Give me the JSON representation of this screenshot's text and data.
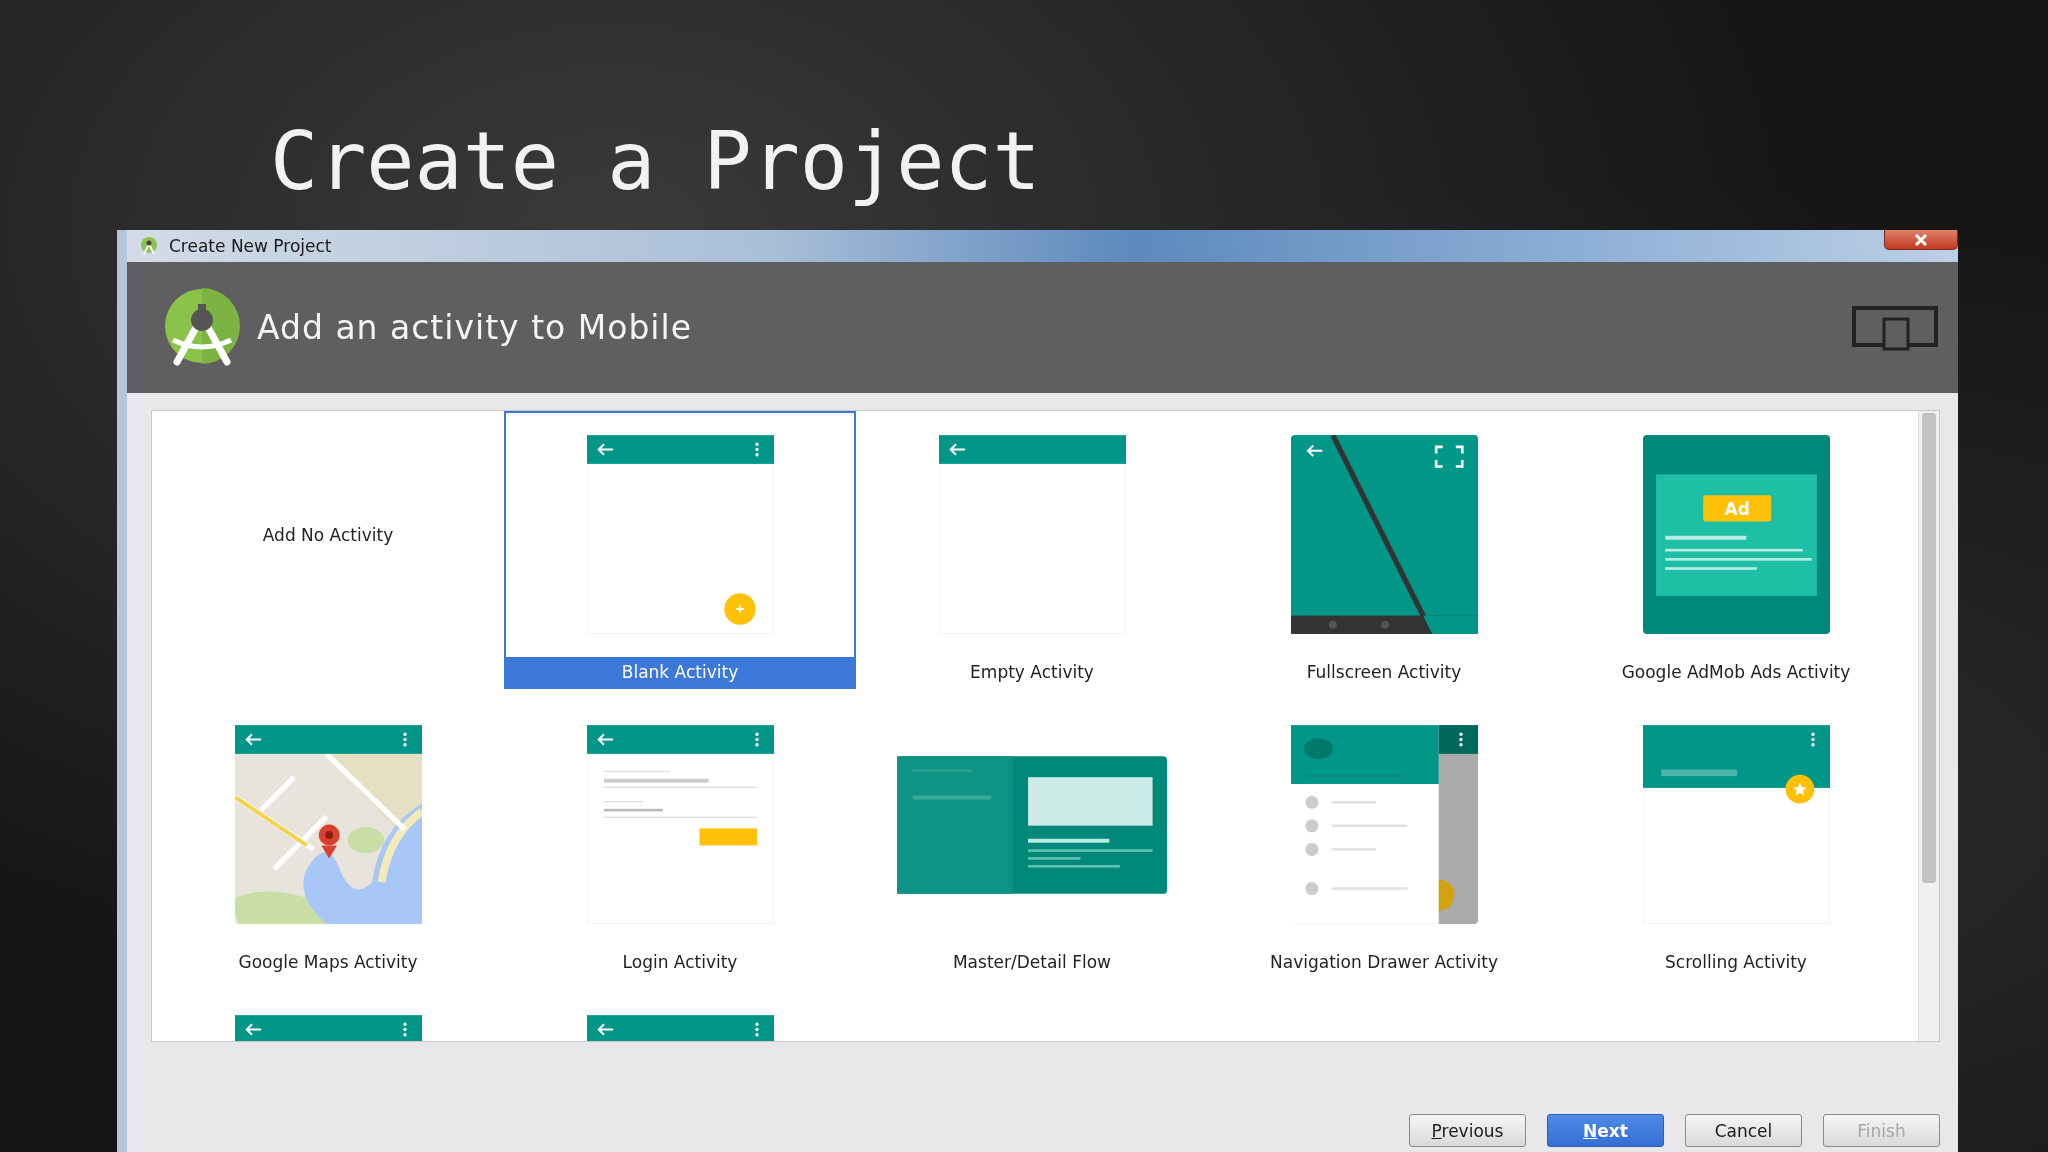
{
  "slide": {
    "title": "Create a Project"
  },
  "window": {
    "title": "Create New Project",
    "header": "Add an activity to Mobile"
  },
  "tiles": [
    {
      "kind": "none",
      "label": "Add No Activity",
      "selected": false
    },
    {
      "kind": "blank",
      "label": "Blank Activity",
      "selected": true
    },
    {
      "kind": "empty",
      "label": "Empty Activity",
      "selected": false
    },
    {
      "kind": "fullscreen",
      "label": "Fullscreen Activity",
      "selected": false
    },
    {
      "kind": "admob",
      "label": "Google AdMob Ads Activity",
      "badge": "Ad",
      "selected": false
    },
    {
      "kind": "maps",
      "label": "Google Maps Activity",
      "selected": false
    },
    {
      "kind": "login",
      "label": "Login Activity",
      "selected": false
    },
    {
      "kind": "masterdetail",
      "label": "Master/Detail Flow",
      "selected": false
    },
    {
      "kind": "navdrawer",
      "label": "Navigation Drawer Activity",
      "selected": false
    },
    {
      "kind": "scrolling",
      "label": "Scrolling Activity",
      "selected": false
    },
    {
      "kind": "tabbed",
      "selected": false
    },
    {
      "kind": "appbar",
      "selected": false
    }
  ],
  "buttons": [
    {
      "key": "P",
      "rest": "revious",
      "primary": false,
      "disabled": false
    },
    {
      "key": "N",
      "rest": "ext",
      "primary": true,
      "disabled": false
    },
    {
      "rest": "Cancel",
      "primary": false,
      "disabled": false
    },
    {
      "rest": "Finish",
      "primary": false,
      "disabled": true
    }
  ]
}
